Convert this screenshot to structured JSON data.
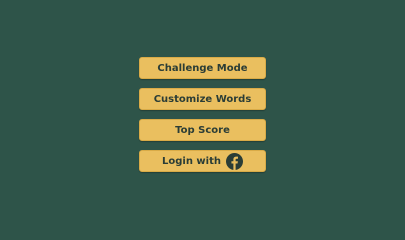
{
  "colors": {
    "background": "#2e5449",
    "button_fill": "#eabf5f",
    "button_text": "#2b3d36",
    "facebook_icon": "#2b3d36"
  },
  "menu": {
    "challenge_mode_label": "Challenge Mode",
    "customize_words_label": "Customize Words",
    "top_score_label": "Top Score",
    "login_label": "Login with",
    "login_icon": "facebook-icon"
  }
}
